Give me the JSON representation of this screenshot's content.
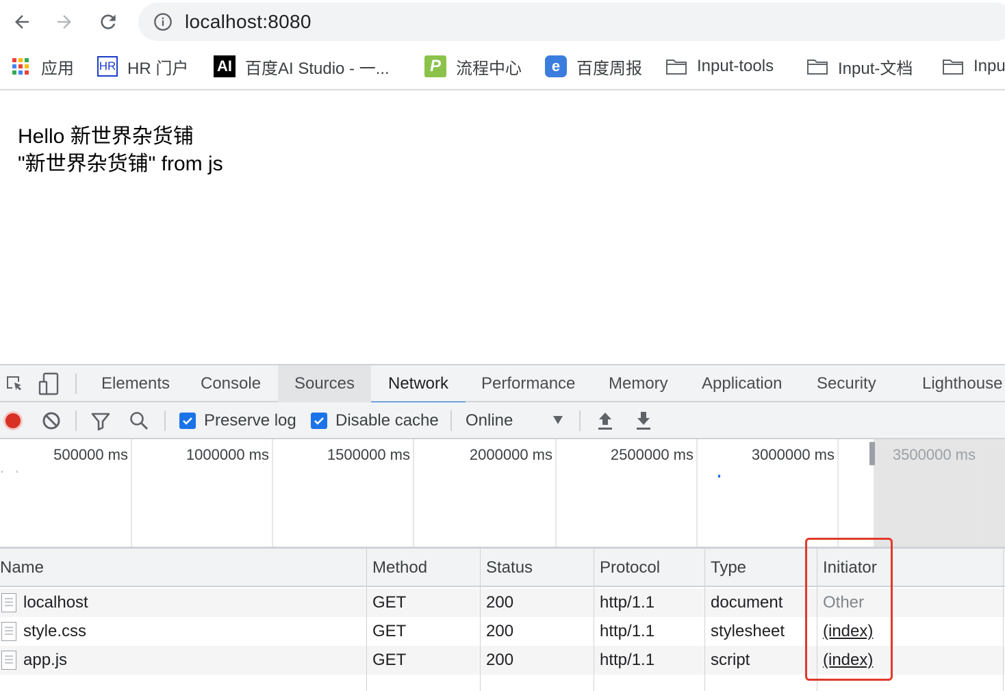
{
  "browser": {
    "url": "localhost:8080",
    "bookmarks": [
      {
        "label": "应用",
        "icon": "apps-grid-icon"
      },
      {
        "label": "HR 门户",
        "icon": "hr-logo-icon",
        "icon_text": "HR"
      },
      {
        "label": "百度AI Studio - 一...",
        "icon": "ai-logo-icon",
        "icon_text": "AI"
      },
      {
        "label": "流程中心",
        "icon": "p-logo-icon",
        "icon_text": "P"
      },
      {
        "label": "百度周报",
        "icon": "e-logo-icon",
        "icon_text": "e"
      },
      {
        "label": "Input-tools",
        "icon": "folder-icon"
      },
      {
        "label": "Input-文档",
        "icon": "folder-icon"
      },
      {
        "label": "Inpu",
        "icon": "folder-icon"
      }
    ]
  },
  "page": {
    "line1": "Hello 新世界杂货铺",
    "line2": "\"新世界杂货铺\" from js"
  },
  "devtools": {
    "tabs": [
      "Elements",
      "Console",
      "Sources",
      "Network",
      "Performance",
      "Memory",
      "Application",
      "Security",
      "Lighthouse"
    ],
    "active_tab": "Network",
    "hover_tab": "Sources",
    "toolbar": {
      "preserve_log": {
        "label": "Preserve log",
        "checked": true
      },
      "disable_cache": {
        "label": "Disable cache",
        "checked": true
      },
      "throttling": "Online"
    },
    "overview_ticks": [
      "500000 ms",
      "1000000 ms",
      "1500000 ms",
      "2000000 ms",
      "2500000 ms",
      "3000000 ms",
      "3500000 ms"
    ],
    "columns": [
      "Name",
      "Method",
      "Status",
      "Protocol",
      "Type",
      "Initiator"
    ],
    "rows": [
      {
        "name": "localhost",
        "method": "GET",
        "status": "200",
        "protocol": "http/1.1",
        "type": "document",
        "initiator": "Other"
      },
      {
        "name": "style.css",
        "method": "GET",
        "status": "200",
        "protocol": "http/1.1",
        "type": "stylesheet",
        "initiator": "(index)"
      },
      {
        "name": "app.js",
        "method": "GET",
        "status": "200",
        "protocol": "http/1.1",
        "type": "script",
        "initiator": "(index)"
      }
    ]
  },
  "colors": {
    "accent": "#1a73e8",
    "record": "#d93025",
    "highlight_box": "#e0392a"
  }
}
